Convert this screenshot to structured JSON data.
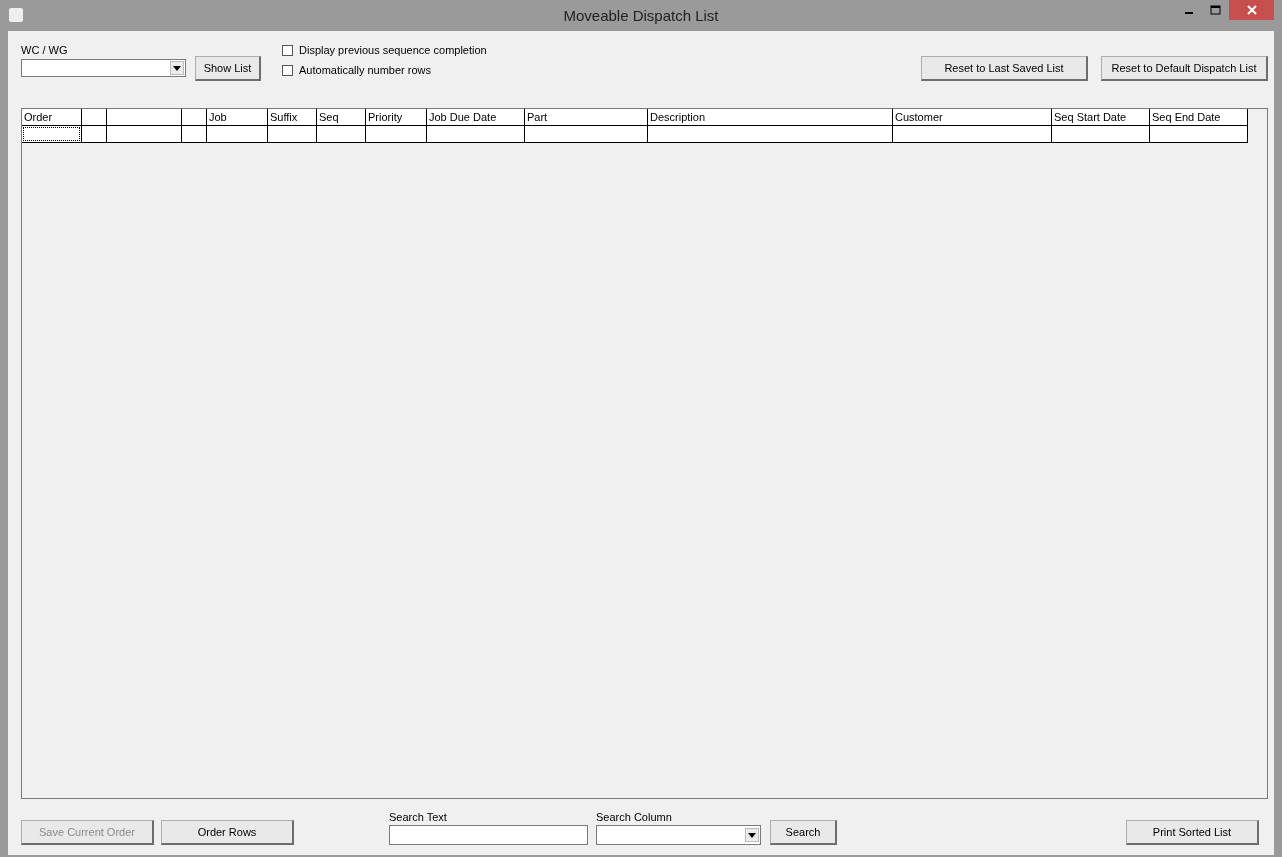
{
  "window": {
    "title": "Moveable Dispatch List"
  },
  "toolbar": {
    "wc_label": "WC / WG",
    "show_list": "Show List",
    "checkboxes": [
      {
        "label": "Display previous sequence completion",
        "checked": false
      },
      {
        "label": "Automatically number rows",
        "checked": false
      }
    ],
    "buttons": [
      {
        "label": "Reset to Last Saved List",
        "disabled": false
      },
      {
        "label": "Reset to Default Dispatch List",
        "disabled": false
      }
    ]
  },
  "table": {
    "columns": [
      {
        "kind": "text",
        "label": "Order"
      },
      {
        "kind": "blank"
      },
      {
        "kind": "blank"
      },
      {
        "kind": "blank"
      },
      {
        "kind": "text",
        "label": "Job"
      },
      {
        "kind": "text",
        "label": "Suffix"
      },
      {
        "kind": "text",
        "label": "Seq"
      },
      {
        "kind": "text",
        "label": "Priority"
      },
      {
        "kind": "text",
        "label": "Job Due Date"
      },
      {
        "kind": "text",
        "label": "Part"
      },
      {
        "kind": "text",
        "label": "Description"
      },
      {
        "kind": "text",
        "label": "Customer"
      },
      {
        "kind": "text",
        "label": "Seq Start Date"
      },
      {
        "kind": "text",
        "label": "Seq End Date"
      }
    ],
    "rows": [
      {
        "cells": [
          {
            "focused": true
          },
          {
            "focused": false
          },
          {
            "focused": false
          },
          {
            "focused": false
          },
          {
            "focused": false
          },
          {
            "focused": false
          },
          {
            "focused": false
          },
          {
            "focused": false
          },
          {
            "focused": false
          },
          {
            "focused": false
          },
          {
            "focused": false
          },
          {
            "focused": false
          },
          {
            "focused": false
          },
          {
            "focused": false
          }
        ]
      }
    ]
  },
  "footer": {
    "left_buttons": [
      {
        "label": "Save Current Order",
        "disabled": true
      },
      {
        "label": "Order Rows",
        "disabled": false
      }
    ],
    "search_text_label": "Search Text",
    "search_column_label": "Search Column",
    "search_button": "Search",
    "print_button": "Print Sorted List"
  }
}
